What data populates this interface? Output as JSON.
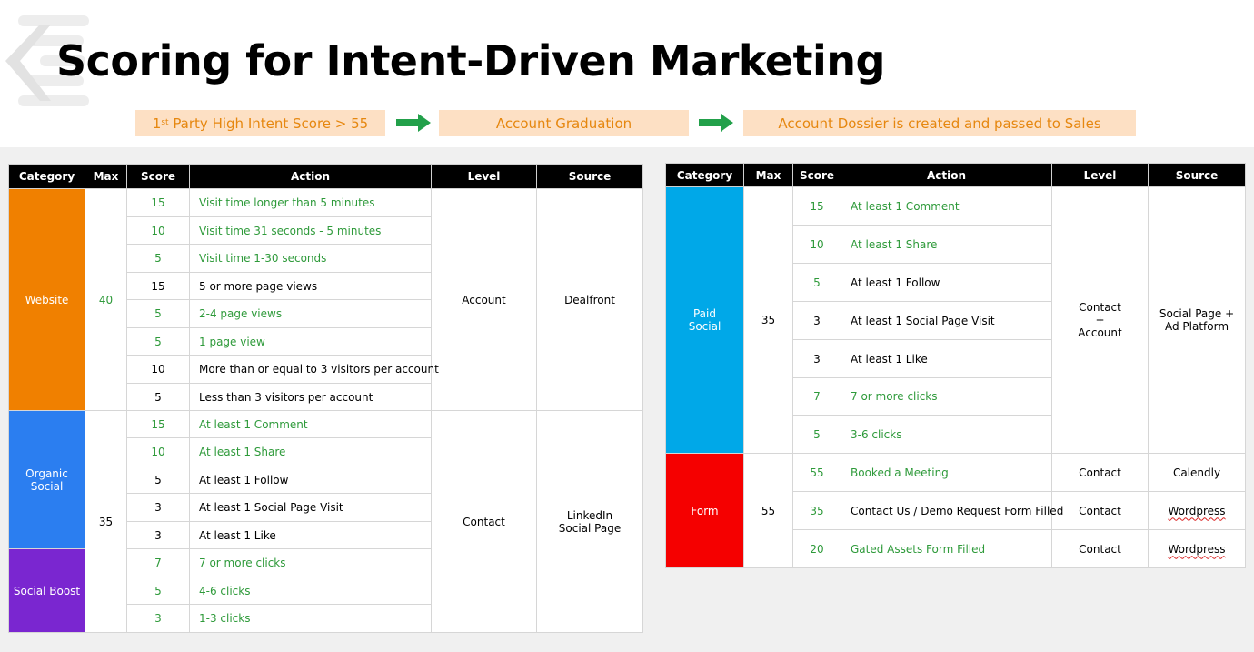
{
  "title": "Scoring for Intent-Driven Marketing",
  "flow": {
    "step1_prefix": "1",
    "step1_sup": "st",
    "step1_rest": " Party High Intent Score > 55",
    "step2": "Account Graduation",
    "step3": "Account Dossier is created and passed to Sales"
  },
  "colors": {
    "website": "#f08000",
    "organic_social": "#2b7ef0",
    "social_boost": "#7a26d0",
    "paid_social": "#00a8e8",
    "form": "#f50000",
    "green_text": "#2e9a3a",
    "flow_fill": "#fde0c4",
    "flow_text": "#e6870f",
    "arrow": "#22a04a"
  },
  "headers": [
    "Category",
    "Max",
    "Score",
    "Action",
    "Level",
    "Source"
  ],
  "left": {
    "website": {
      "category": "Website",
      "max": "40",
      "level": "Account",
      "source": "Dealfront",
      "rows": [
        {
          "score": "15",
          "action": "Visit time longer than 5 minutes"
        },
        {
          "score": "10",
          "action": "Visit time 31 seconds - 5 minutes"
        },
        {
          "score": "5",
          "action": "Visit time 1-30 seconds"
        },
        {
          "score": "15",
          "action": "5 or more page views"
        },
        {
          "score": "5",
          "action": "2-4 page views"
        },
        {
          "score": "5",
          "action": "1 page view"
        },
        {
          "score": "10",
          "action": "More than or equal to 3 visitors per account"
        },
        {
          "score": "5",
          "action": "Less than 3 visitors per account"
        }
      ]
    },
    "social": {
      "organic_line1": "Organic",
      "organic_line2": "Social",
      "boost": "Social Boost",
      "max": "35",
      "level": "Contact",
      "source_line1": "LinkedIn",
      "source_line2": "Social Page",
      "rows": [
        {
          "score": "15",
          "action": "At least 1 Comment"
        },
        {
          "score": "10",
          "action": "At least 1 Share"
        },
        {
          "score": "5",
          "action": "At least 1 Follow"
        },
        {
          "score": "3",
          "action": "At least 1 Social Page Visit"
        },
        {
          "score": "3",
          "action": "At least 1 Like"
        },
        {
          "score": "7",
          "action": "7 or more clicks"
        },
        {
          "score": "5",
          "action": "4-6 clicks"
        },
        {
          "score": "3",
          "action": "1-3 clicks"
        }
      ]
    }
  },
  "right": {
    "paid": {
      "category_line1": "Paid",
      "category_line2": "Social",
      "max": "35",
      "level_line1": "Contact",
      "level_line2": "+",
      "level_line3": "Account",
      "source_line1": "Social Page +",
      "source_line2": "Ad Platform",
      "rows": [
        {
          "score": "15",
          "action": "At least 1 Comment"
        },
        {
          "score": "10",
          "action": "At least 1 Share"
        },
        {
          "score": "5",
          "action": "At least 1 Follow"
        },
        {
          "score": "3",
          "action": "At least 1 Social Page Visit"
        },
        {
          "score": "3",
          "action": "At least 1 Like"
        },
        {
          "score": "7",
          "action": "7 or more clicks"
        },
        {
          "score": "5",
          "action": "3-6 clicks"
        }
      ]
    },
    "form": {
      "category": "Form",
      "max": "55",
      "rows": [
        {
          "score": "55",
          "action": "Booked a Meeting",
          "level": "Contact",
          "source": "Calendly"
        },
        {
          "score": "35",
          "action": "Contact Us / Demo Request Form Filled",
          "level": "Contact",
          "source": "Wordpress"
        },
        {
          "score": "20",
          "action": "Gated Assets Form Filled",
          "level": "Contact",
          "source": "Wordpress"
        }
      ]
    }
  }
}
